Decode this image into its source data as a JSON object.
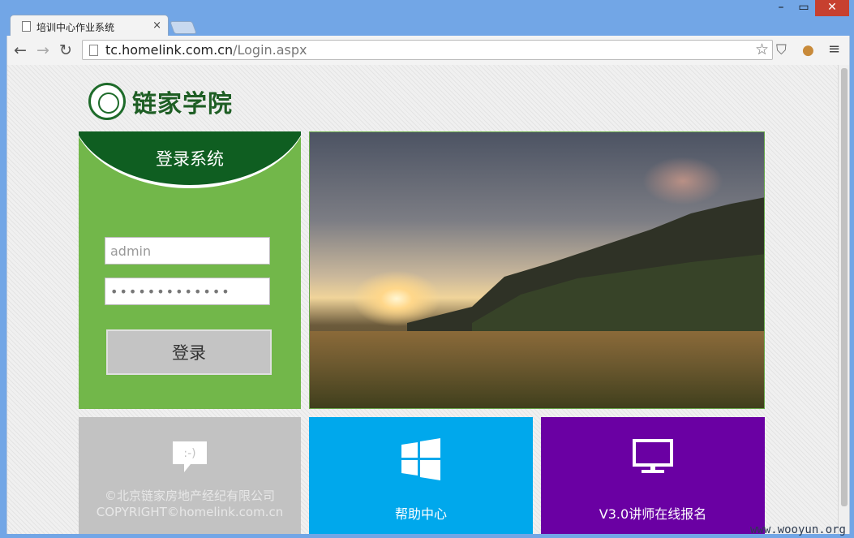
{
  "browser": {
    "tab_title": "培训中心作业系统",
    "tab_close": "×",
    "url_host": "tc.homelink.com.cn",
    "url_path": "/Login.aspx",
    "back": "←",
    "forward": "→",
    "reload": "↻",
    "star": "☆",
    "window_min": "–",
    "window_max": "▭",
    "window_close": "✕",
    "menu": "≡"
  },
  "logo": {
    "text": "链家学院"
  },
  "login": {
    "title": "登录系统",
    "username_value": "admin",
    "password_value": "•••••••••••••",
    "submit_label": "登录"
  },
  "tiles": {
    "copyright_line1": "©北京链家房地产经纪有限公司",
    "copyright_line2": "COPYRIGHT©homelink.com.cn",
    "help_label": "帮助中心",
    "register_label": "V3.0讲师在线报名",
    "copy_icon_text": ":-)"
  },
  "watermark": "www.wooyun.org",
  "colors": {
    "login_green": "#72b74a",
    "dark_green": "#0f5e21",
    "help_blue": "#00a8ec",
    "register_purple": "#6a00a3",
    "copyright_gray": "#c2c2c2"
  }
}
